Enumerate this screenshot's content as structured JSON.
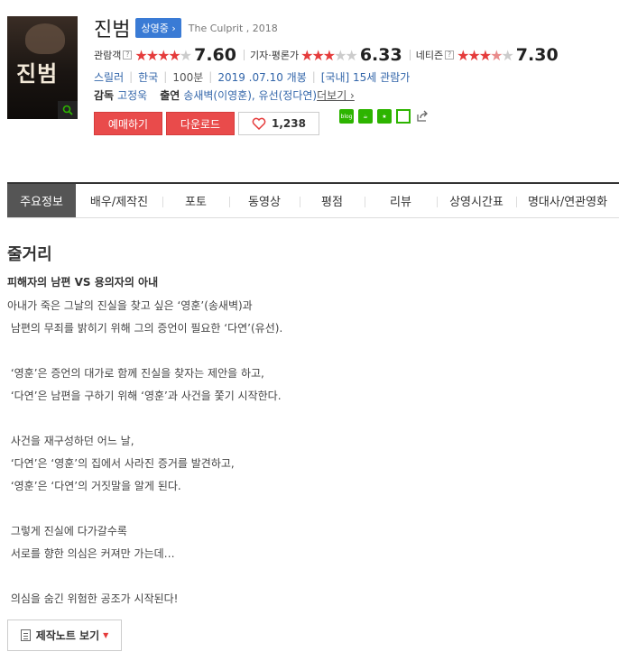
{
  "movie": {
    "title": "진범",
    "status": "상영중 ›",
    "subtitle": "The Culprit , 2018",
    "poster_text": "진범"
  },
  "ratings": [
    {
      "label": "관람객",
      "score": "7.60",
      "stars_filled": 4,
      "help": "?"
    },
    {
      "label": "기자·평론가",
      "score": "6.33",
      "stars_filled": 3,
      "help": ""
    },
    {
      "label": "네티즌",
      "score": "7.30",
      "stars_filled": 3.5,
      "help": "?"
    }
  ],
  "meta": {
    "genre": "스릴러",
    "country": "한국",
    "runtime": "100분",
    "release": "2019 .07.10 개봉",
    "rating": "[국내] 15세 관람가"
  },
  "credits": {
    "director_label": "감독",
    "director": "고정욱",
    "cast_label": "출연",
    "cast": "송새벽(이영훈), 유선(정다연)",
    "more": "더보기 ›"
  },
  "actions": {
    "reserve": "예매하기",
    "download": "다운로드",
    "likes": "1,238"
  },
  "tabs": [
    "주요정보",
    "배우/제작진",
    "포토",
    "동영상",
    "평점",
    "리뷰",
    "상영시간표",
    "명대사/연관영화"
  ],
  "synopsis": {
    "title": "줄거리",
    "headline": "피해자의 남편 VS 용의자의 아내",
    "body": "아내가 죽은 그날의 진실을 찾고 싶은 ‘영훈’(송새벽)과\n 남편의 무죄를 밝히기 위해 그의 증언이 필요한 ‘다연’(유선).\n\n ‘영훈’은 증언의 대가로 함께 진실을 찾자는 제안을 하고,\n ‘다연’은 남편을 구하기 위해 ‘영훈’과 사건을 쫓기 시작한다.\n\n 사건을 재구성하던 어느 날,\n ‘다연’은 ‘영훈’의 집에서 사라진 증거를 발견하고,\n ‘영훈’은 ‘다연’의 거짓말을 알게 된다.\n\n 그렇게 진실에 다가갈수록\n 서로를 향한 의심은 커져만 가는데…\n\n 의심을 숨긴 위험한 공조가 시작된다!"
  },
  "note_button": "제작노트 보기",
  "colors": {
    "accent_red": "#e94b4b",
    "badge_blue": "#3a7bd5",
    "link_blue": "#3366aa",
    "share_green": "#2db400"
  }
}
